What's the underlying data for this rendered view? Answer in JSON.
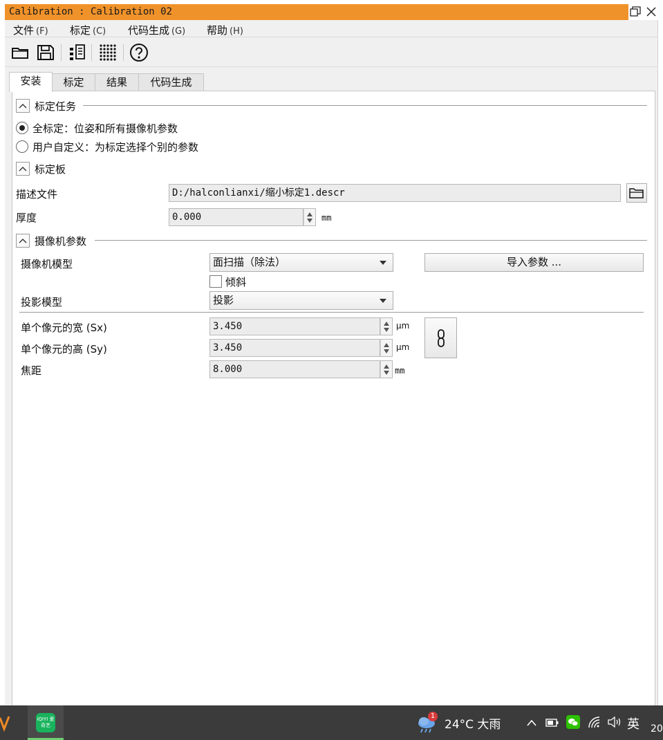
{
  "window": {
    "title": "Calibration : Calibration 02"
  },
  "menu": [
    {
      "label": "文件",
      "key": "(F)"
    },
    {
      "label": "标定",
      "key": "(C)"
    },
    {
      "label": "代码生成",
      "key": "(G)"
    },
    {
      "label": "帮助",
      "key": "(H)"
    }
  ],
  "toolbar": [
    "open-folder-icon",
    "save-icon",
    "calibration-plate-list-icon",
    "dot-grid-icon",
    "help-icon"
  ],
  "tabs": [
    "安装",
    "标定",
    "结果",
    "代码生成"
  ],
  "task_group": {
    "title": "标定任务",
    "options": [
      {
        "label": "全标定：位姿和所有摄像机参数",
        "selected": true
      },
      {
        "label": "用户自定义：为标定选择个别的参数",
        "selected": false
      }
    ]
  },
  "plate_group": {
    "title": "标定板",
    "desc_label": "描述文件",
    "desc_value": "D:/halconlianxi/缩小标定1.descr",
    "thickness_label": "厚度",
    "thickness_value": "0.000",
    "thickness_unit": "mm"
  },
  "camera_group": {
    "title": "摄像机参数",
    "model_label": "摄像机模型",
    "model_value": "面扫描（除法）",
    "import_button": "导入参数 ...",
    "tilt_label": "倾斜",
    "tilt_checked": false,
    "projection_label": "投影模型",
    "projection_value": "投影",
    "sx_label": "单个像元的宽 (Sx)",
    "sx_value": "3.450",
    "sx_unit": "μm",
    "sy_label": "单个像元的高 (Sy)",
    "sy_value": "3.450",
    "sy_unit": "μm",
    "focal_label": "焦距",
    "focal_value": "8.000",
    "focal_unit": "mm"
  },
  "taskbar": {
    "weather_badge": "1",
    "weather": "24°C 大雨",
    "ime": "英",
    "clock_partial": "20",
    "app_label": "iQIYI 爱奇艺"
  },
  "colors": {
    "titlebar": "#f0922a",
    "window_bg": "#f0f0f0",
    "taskbar": "#3b3b3b",
    "wechat": "#2dc100",
    "iqiyi": "#18b35c"
  }
}
